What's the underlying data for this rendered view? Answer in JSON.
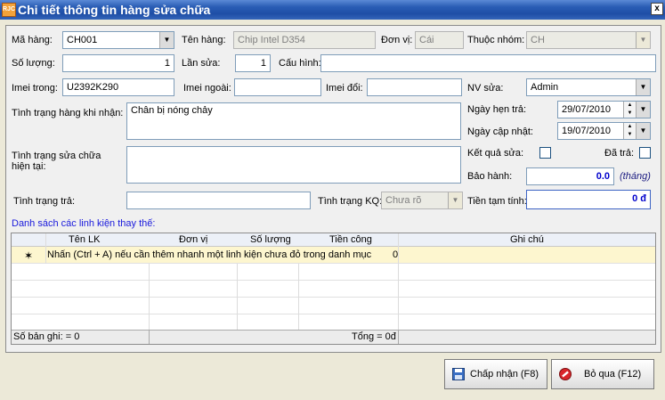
{
  "window": {
    "app_icon_text": "RJC",
    "title": "Chi tiết thông tin hàng  sửa chữa",
    "close_glyph": "x"
  },
  "form": {
    "ma_hang": {
      "label": "Mã hàng:",
      "value": "CH001"
    },
    "ten_hang": {
      "label": "Tên hàng:",
      "value": "Chip Intel D354"
    },
    "don_vi": {
      "label": "Đơn vị:",
      "value": "Cái"
    },
    "thuoc_nhom": {
      "label": "Thuộc nhóm:",
      "value": "CH"
    },
    "so_luong": {
      "label": "Số lượng:",
      "value": "1"
    },
    "lan_sua": {
      "label": "Lần sửa:",
      "value": "1"
    },
    "cau_hinh": {
      "label": "Cấu hình:",
      "value": ""
    },
    "imei_trong": {
      "label": "Imei trong:",
      "value": "U2392K290"
    },
    "imei_ngoai": {
      "label": "Imei ngoài:",
      "value": ""
    },
    "imei_doi": {
      "label": "Imei đổi:",
      "value": ""
    },
    "nv_sua": {
      "label": "NV sửa:",
      "value": "Admin"
    },
    "ngay_hen_tra": {
      "label": "Ngày hẹn trả:",
      "value": "29/07/2010"
    },
    "ngay_cap_nhat": {
      "label": "Ngày cập nhật:",
      "value": "19/07/2010"
    },
    "tinh_trang_nhan": {
      "label": "Tình trạng hàng khi nhận:",
      "value": "Chân bị nóng chảy"
    },
    "tinh_trang_sua": {
      "label_line1": "Tình trạng sửa chữa",
      "label_line2": "hiện tại:",
      "value": ""
    },
    "ket_qua_sua": {
      "label": "Kết quả sửa:"
    },
    "da_tra": {
      "label": "Đã trả:"
    },
    "bao_hanh": {
      "label": "Bảo hành:",
      "value": "0.0",
      "unit": "(tháng)"
    },
    "tinh_trang_tra": {
      "label": "Tình trạng trả:",
      "value": ""
    },
    "tinh_trang_kq": {
      "label": "Tình trạng KQ:",
      "value": "Chưa rõ"
    },
    "tien_tam_tinh": {
      "label": "Tiền tạm tính:",
      "value": "0 đ"
    }
  },
  "grid": {
    "title": "Danh sách các linh kiện thay thế:",
    "columns": [
      "Tên LK",
      "Đơn vị",
      "Số lượng",
      "Tiền công",
      "Ghi chú"
    ],
    "new_row": {
      "marker": "✶",
      "hint": "Nhấn (Ctrl + A) nếu cần thêm nhanh một linh kiện chưa đỏ trong danh mục",
      "tien_cong": "0"
    },
    "footer": {
      "record_count": "Số bản ghi: = 0",
      "total": "Tổng = 0đ"
    }
  },
  "buttons": {
    "accept": "Chấp nhận (F8)",
    "cancel": "Bỏ qua (F12)"
  },
  "icons": {
    "save": "floppy-disk-icon",
    "cancel": "no-entry-icon",
    "dropdown": "▼",
    "spin_up": "▲",
    "spin_down": "▼"
  }
}
